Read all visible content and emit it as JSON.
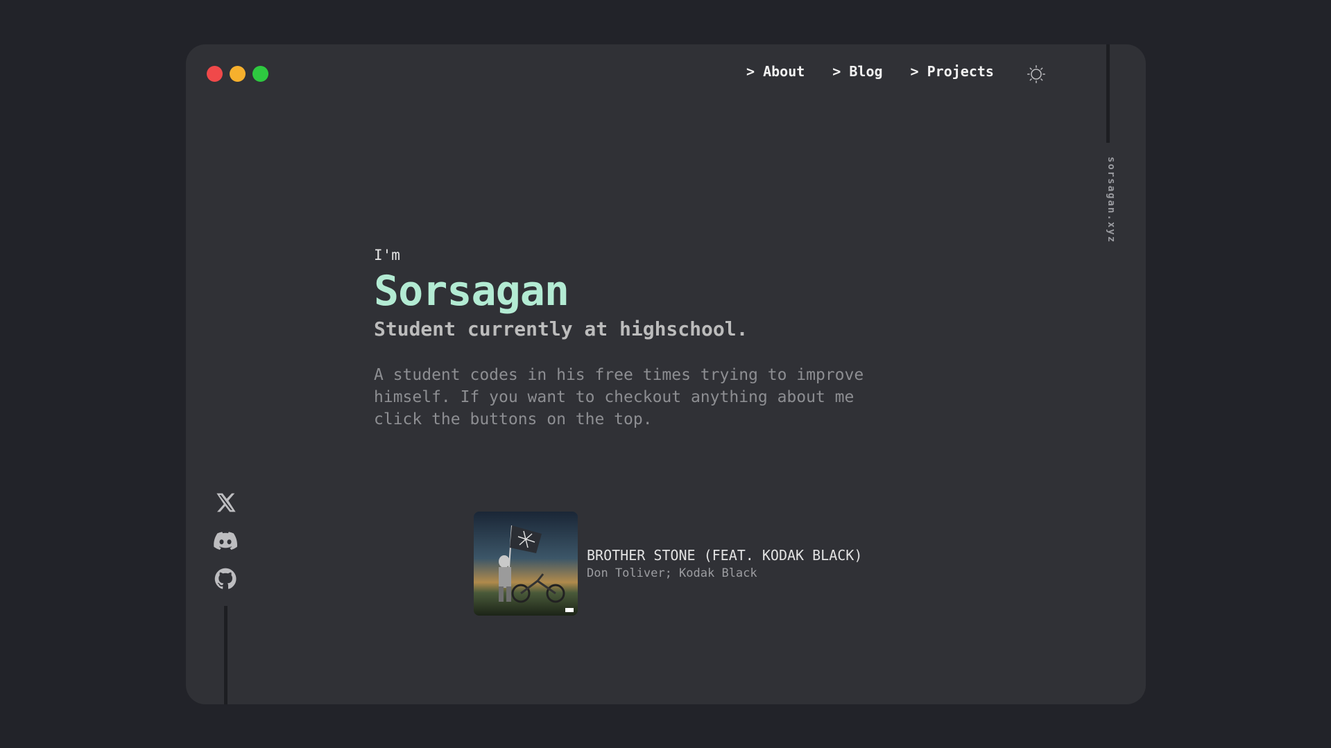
{
  "window": {
    "traffic_lights": [
      {
        "name": "close",
        "color": "#f0494a"
      },
      {
        "name": "minimize",
        "color": "#f6b02d"
      },
      {
        "name": "maximize",
        "color": "#2ec940"
      }
    ]
  },
  "nav": {
    "items": [
      {
        "label": "> About"
      },
      {
        "label": "> Blog"
      },
      {
        "label": "> Projects"
      }
    ],
    "theme_toggle_icon": "sun-icon"
  },
  "side_label": "sorsagan.xyz",
  "intro": {
    "greeting": "I'm",
    "name": "Sorsagan",
    "tagline": "Student currently at highschool.",
    "description": "A student codes in his free times trying to improve himself. If you want to checkout anything about me click the buttons on the top."
  },
  "socials": [
    {
      "icon": "x-twitter-icon"
    },
    {
      "icon": "discord-icon"
    },
    {
      "icon": "github-icon"
    }
  ],
  "now_playing": {
    "title": "BROTHER STONE (FEAT. KODAK BLACK)",
    "artist": "Don Toliver; Kodak Black"
  },
  "colors": {
    "background": "#222329",
    "window": "#303136",
    "accent": "#b3ebd3"
  }
}
